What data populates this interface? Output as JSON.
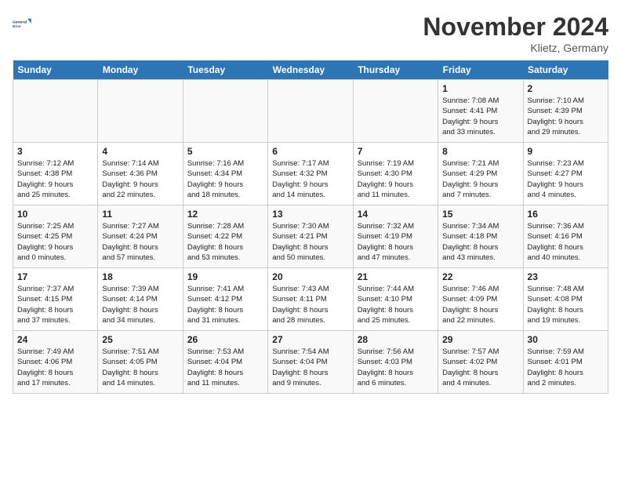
{
  "app": {
    "logo_line1": "General",
    "logo_line2": "Blue"
  },
  "title": "November 2024",
  "location": "Klietz, Germany",
  "days_of_week": [
    "Sunday",
    "Monday",
    "Tuesday",
    "Wednesday",
    "Thursday",
    "Friday",
    "Saturday"
  ],
  "weeks": [
    [
      {
        "day": "",
        "info": ""
      },
      {
        "day": "",
        "info": ""
      },
      {
        "day": "",
        "info": ""
      },
      {
        "day": "",
        "info": ""
      },
      {
        "day": "",
        "info": ""
      },
      {
        "day": "1",
        "info": "Sunrise: 7:08 AM\nSunset: 4:41 PM\nDaylight: 9 hours\nand 33 minutes."
      },
      {
        "day": "2",
        "info": "Sunrise: 7:10 AM\nSunset: 4:39 PM\nDaylight: 9 hours\nand 29 minutes."
      }
    ],
    [
      {
        "day": "3",
        "info": "Sunrise: 7:12 AM\nSunset: 4:38 PM\nDaylight: 9 hours\nand 25 minutes."
      },
      {
        "day": "4",
        "info": "Sunrise: 7:14 AM\nSunset: 4:36 PM\nDaylight: 9 hours\nand 22 minutes."
      },
      {
        "day": "5",
        "info": "Sunrise: 7:16 AM\nSunset: 4:34 PM\nDaylight: 9 hours\nand 18 minutes."
      },
      {
        "day": "6",
        "info": "Sunrise: 7:17 AM\nSunset: 4:32 PM\nDaylight: 9 hours\nand 14 minutes."
      },
      {
        "day": "7",
        "info": "Sunrise: 7:19 AM\nSunset: 4:30 PM\nDaylight: 9 hours\nand 11 minutes."
      },
      {
        "day": "8",
        "info": "Sunrise: 7:21 AM\nSunset: 4:29 PM\nDaylight: 9 hours\nand 7 minutes."
      },
      {
        "day": "9",
        "info": "Sunrise: 7:23 AM\nSunset: 4:27 PM\nDaylight: 9 hours\nand 4 minutes."
      }
    ],
    [
      {
        "day": "10",
        "info": "Sunrise: 7:25 AM\nSunset: 4:25 PM\nDaylight: 9 hours\nand 0 minutes."
      },
      {
        "day": "11",
        "info": "Sunrise: 7:27 AM\nSunset: 4:24 PM\nDaylight: 8 hours\nand 57 minutes."
      },
      {
        "day": "12",
        "info": "Sunrise: 7:28 AM\nSunset: 4:22 PM\nDaylight: 8 hours\nand 53 minutes."
      },
      {
        "day": "13",
        "info": "Sunrise: 7:30 AM\nSunset: 4:21 PM\nDaylight: 8 hours\nand 50 minutes."
      },
      {
        "day": "14",
        "info": "Sunrise: 7:32 AM\nSunset: 4:19 PM\nDaylight: 8 hours\nand 47 minutes."
      },
      {
        "day": "15",
        "info": "Sunrise: 7:34 AM\nSunset: 4:18 PM\nDaylight: 8 hours\nand 43 minutes."
      },
      {
        "day": "16",
        "info": "Sunrise: 7:36 AM\nSunset: 4:16 PM\nDaylight: 8 hours\nand 40 minutes."
      }
    ],
    [
      {
        "day": "17",
        "info": "Sunrise: 7:37 AM\nSunset: 4:15 PM\nDaylight: 8 hours\nand 37 minutes."
      },
      {
        "day": "18",
        "info": "Sunrise: 7:39 AM\nSunset: 4:14 PM\nDaylight: 8 hours\nand 34 minutes."
      },
      {
        "day": "19",
        "info": "Sunrise: 7:41 AM\nSunset: 4:12 PM\nDaylight: 8 hours\nand 31 minutes."
      },
      {
        "day": "20",
        "info": "Sunrise: 7:43 AM\nSunset: 4:11 PM\nDaylight: 8 hours\nand 28 minutes."
      },
      {
        "day": "21",
        "info": "Sunrise: 7:44 AM\nSunset: 4:10 PM\nDaylight: 8 hours\nand 25 minutes."
      },
      {
        "day": "22",
        "info": "Sunrise: 7:46 AM\nSunset: 4:09 PM\nDaylight: 8 hours\nand 22 minutes."
      },
      {
        "day": "23",
        "info": "Sunrise: 7:48 AM\nSunset: 4:08 PM\nDaylight: 8 hours\nand 19 minutes."
      }
    ],
    [
      {
        "day": "24",
        "info": "Sunrise: 7:49 AM\nSunset: 4:06 PM\nDaylight: 8 hours\nand 17 minutes."
      },
      {
        "day": "25",
        "info": "Sunrise: 7:51 AM\nSunset: 4:05 PM\nDaylight: 8 hours\nand 14 minutes."
      },
      {
        "day": "26",
        "info": "Sunrise: 7:53 AM\nSunset: 4:04 PM\nDaylight: 8 hours\nand 11 minutes."
      },
      {
        "day": "27",
        "info": "Sunrise: 7:54 AM\nSunset: 4:04 PM\nDaylight: 8 hours\nand 9 minutes."
      },
      {
        "day": "28",
        "info": "Sunrise: 7:56 AM\nSunset: 4:03 PM\nDaylight: 8 hours\nand 6 minutes."
      },
      {
        "day": "29",
        "info": "Sunrise: 7:57 AM\nSunset: 4:02 PM\nDaylight: 8 hours\nand 4 minutes."
      },
      {
        "day": "30",
        "info": "Sunrise: 7:59 AM\nSunset: 4:01 PM\nDaylight: 8 hours\nand 2 minutes."
      }
    ]
  ]
}
